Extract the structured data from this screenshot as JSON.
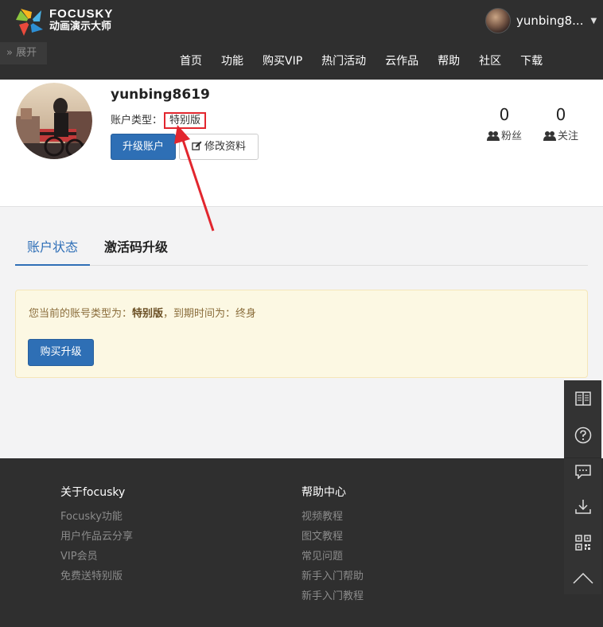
{
  "header": {
    "brand_line1": "FOCUSKY",
    "brand_line2": "动画演示大师",
    "username_short": "yunbing8...",
    "expand_label": "» 展开",
    "nav": [
      "首页",
      "功能",
      "购买VIP",
      "热门活动",
      "云作品",
      "帮助",
      "社区",
      "下载"
    ]
  },
  "profile": {
    "username": "yunbing8619",
    "account_type_label": "账户类型：",
    "account_type_value": "特别版",
    "upgrade_button": "升级账户",
    "edit_button": "修改资料",
    "fans_count": "0",
    "fans_label": "粉丝",
    "follow_count": "0",
    "follow_label": "关注"
  },
  "tabs": {
    "account_status": "账户状态",
    "activation_upgrade": "激活码升级"
  },
  "status": {
    "prefix": "您当前的账号类型为：",
    "type": "特别版",
    "suffix": "，到期时间为：终身",
    "buy_button": "购买升级"
  },
  "footer": {
    "about": {
      "title": "关于focusky",
      "links": [
        "Focusky功能",
        "用户作品云分享",
        "VIP会员",
        "免费送特别版"
      ]
    },
    "help": {
      "title": "帮助中心",
      "links": [
        "视频教程",
        "图文教程",
        "常见问题",
        "新手入门帮助",
        "新手入门教程"
      ]
    }
  },
  "sidebar_icons": [
    "book-icon",
    "help-icon",
    "chat-icon",
    "download-icon",
    "qr-code-icon",
    "scroll-top-icon"
  ],
  "colors": {
    "primary": "#2e6fb5",
    "highlight": "#e2262e",
    "header_bg": "#2f2f2f",
    "notice_bg": "#fcf8e3"
  }
}
